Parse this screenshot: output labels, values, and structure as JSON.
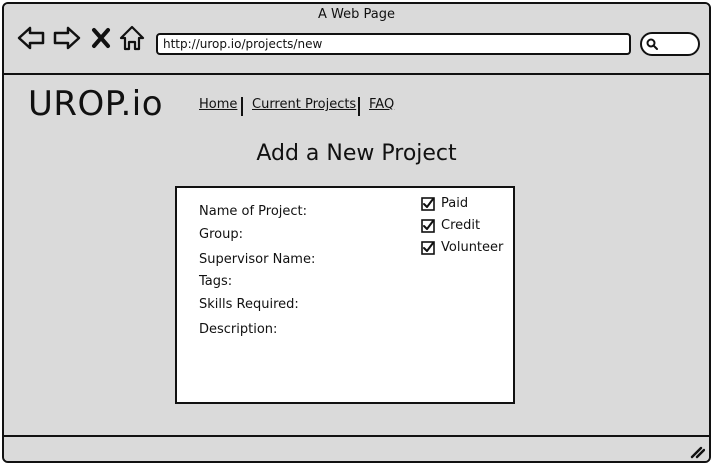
{
  "window": {
    "title": "A Web Page"
  },
  "browser": {
    "url": "http://urop.io/projects/new",
    "icons": [
      "back-arrow-icon",
      "forward-arrow-icon",
      "close-x-icon",
      "home-icon",
      "search-icon"
    ]
  },
  "site": {
    "logo": "UROP.io",
    "nav": [
      {
        "label": "Home"
      },
      {
        "label": "Current Projects"
      },
      {
        "label": "FAQ"
      }
    ]
  },
  "page": {
    "title": "Add a New Project"
  },
  "form": {
    "fields": [
      {
        "label": "Name of Project:"
      },
      {
        "label": "Group:"
      },
      {
        "label": "Supervisor Name:"
      },
      {
        "label": "Tags:"
      },
      {
        "label": "Skills Required:"
      },
      {
        "label": "Description:"
      }
    ],
    "checkboxes": [
      {
        "label": "Paid",
        "checked": true
      },
      {
        "label": "Credit",
        "checked": true
      },
      {
        "label": "Volunteer",
        "checked": true
      }
    ]
  },
  "colors": {
    "chrome": "#dadada",
    "card": "#ffffff",
    "ink": "#111111"
  }
}
